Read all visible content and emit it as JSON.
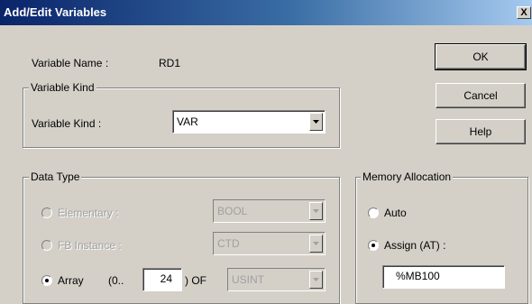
{
  "window": {
    "title": "Add/Edit Variables",
    "close_label": "X"
  },
  "variable_name": {
    "label": "Variable Name :",
    "value": "RD1"
  },
  "variable_kind": {
    "group_label": "Variable Kind",
    "label": "Variable Kind :",
    "selected": "VAR"
  },
  "buttons": {
    "ok": "OK",
    "cancel": "Cancel",
    "help": "Help"
  },
  "data_type": {
    "group_label": "Data Type",
    "elementary": {
      "label": "Elementary :",
      "value": "BOOL",
      "checked": false,
      "enabled": false
    },
    "fb_instance": {
      "label": "FB Instance :",
      "value": "CTD",
      "checked": false,
      "enabled": false
    },
    "array": {
      "label": "Array",
      "range_prefix": "(0..",
      "upper_bound": "24",
      "range_suffix": ") OF",
      "element_type": "USINT",
      "checked": true
    }
  },
  "memory_allocation": {
    "group_label": "Memory Allocation",
    "auto": {
      "label": "Auto",
      "checked": false
    },
    "assign": {
      "label": "Assign (AT) :",
      "checked": true
    },
    "address": "%MB100"
  },
  "colors": {
    "title_gradient_start": "#0a246a",
    "title_gradient_end": "#a6caf0",
    "dialog_face": "#d4d0c8",
    "disabled_text": "#a0a0a0"
  }
}
